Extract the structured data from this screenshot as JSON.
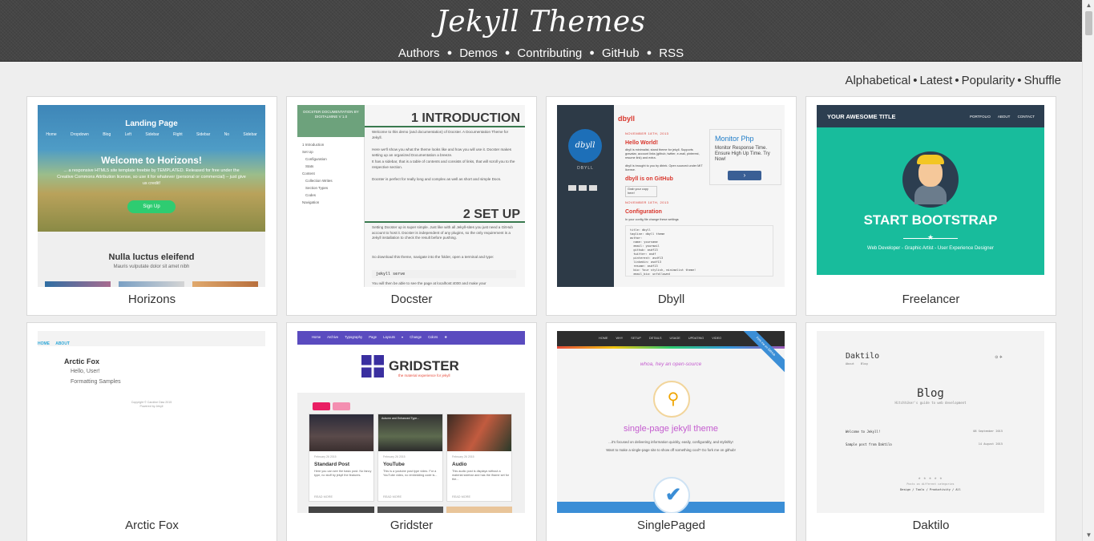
{
  "header": {
    "title": "Jekyll Themes",
    "nav": [
      "Authors",
      "Demos",
      "Contributing",
      "GitHub",
      "RSS"
    ]
  },
  "sort": [
    "Alphabetical",
    "Latest",
    "Popularity",
    "Shuffle"
  ],
  "themes": [
    {
      "name": "Horizons",
      "preview": {
        "title": "Landing Page",
        "nav": "Home Dropdown Blog Left Sidebar Right Sidebar No Sidebar",
        "headline": "Welcome to Horizons!",
        "description": "... a responsive HTML5 site template freebie by TEMPLATED. Released for free under the Creative Commons Attribution license, so use it for whatever (personal or commercial) – just give us credit!",
        "button": "Sign Up",
        "section_title": "Nulla luctus eleifend",
        "section_sub": "Mauris vulputate dolor sit amet nibh"
      }
    },
    {
      "name": "Docster",
      "preview": {
        "side_title": "DOCSTER DOCUMENTATION BY DIGITALMINE V 1.0",
        "side_items": [
          "1 Introduction",
          "Set Up",
          "Configuration",
          "Stats",
          "Content",
          "Collection Writes",
          "Section Types",
          "Codes",
          "Navigation"
        ],
        "h1": "1 INTRODUCTION",
        "intro_1": "Welcome to this demo (and documentation) of Docster. A Documentation Theme for Jekyll.",
        "intro_2": "Here we'll show you what the theme looks like and how you will use it. Docster makes setting up an organized Documentation a breeze.",
        "intro_3": "It has a sidebar, that is a table of contents and consists of links, that will scroll you to the respective section.",
        "intro_4": "Docster is perfect for really long and complex as well as short and simple Docs.",
        "h2": "2 SET UP",
        "setup_1": "Setting Docster up is super simple. Just like with all Jekyll-sites you just need a GitHub account to host it. Docster is independent of any plugins, so the only requirement is a Jekyll installation to check the result before pushing.",
        "setup_2": "So download this theme, navigate into the folder, open a terminal and type:",
        "code": "jekyll serve",
        "setup_3": "You will then be able to see the page at localhost:4000 and make your"
      }
    },
    {
      "name": "Dbyll",
      "preview": {
        "logo": "dbyll",
        "side_name": "DBYLL",
        "brand": "dbyll",
        "date_1": "NOVEMBER 18TH, 2013",
        "post_1": "Hello World!",
        "post_1_text": "dbyll is minimalist, stand theme for jekyll. Supports gravatar, account links (github, twitter, e-mail, pinterest, resume link) and extra.",
        "post_1_text_2": "dbyll is brought to you by dbtek. Open sourced under MIT license.",
        "post_2": "dbyll is on GitHub",
        "post_2_btn": "Grab your copy here!",
        "date_2": "NOVEMBER 18TH, 2013",
        "post_3": "Configuration",
        "post_3_text": "In your config file change these settings",
        "code": "title: dbyll\ntagline: dbyll theme\nauthor:\n  name: yourname\n  email: yourmail\n  github: asdf13\n  twitter: asdf\n  pinterest: asdf13\n  linkedin: asdf13\n  resume: asdf13\n  bio: Your stylish, minimalist theme!\n  email_bio: unfollowed",
        "ad_title": "Monitor Php",
        "ad_text": "Monitor Response Time. Ensure High Up Time. Try Now!"
      }
    },
    {
      "name": "Freelancer",
      "preview": {
        "brand": "YOUR AWESOME TITLE",
        "links": "PORTFOLIO ABOUT CONTACT",
        "headline": "START BOOTSTRAP",
        "sub": "Web Developer - Graphic Artist - User Experience Designer"
      }
    },
    {
      "name": "Arctic Fox",
      "preview": {
        "nav": "HOME ABOUT",
        "title": "Arctic Fox",
        "items": [
          "Hello, User!",
          "Formatting Samples"
        ],
        "copyright": "Copyright © Caroline Diaz 2015",
        "powered": "Powered by Jekyll"
      }
    },
    {
      "name": "Gridster",
      "preview": {
        "menu": "Home Archive Typography Page Layouts ▾ Change Colors ❖",
        "logo": "GRIDSTER",
        "tagline": "the material experience for jekyll",
        "cards": [
          {
            "meta": "February 26 2015",
            "title": "Standard Post",
            "text": "Here you can see the basic post. No fancy type, no stuff by jekyll the features.",
            "more": "READ MORE"
          },
          {
            "meta": "February 26 2015",
            "title": "YouTube",
            "text": "This is a youtube post type video. For a YouTube video, no embedding code is...",
            "more": "READ MORE"
          },
          {
            "meta": "February 26 2015",
            "title": "Audio",
            "text": "This audio post is displays without a material sidebar and has the iframe set for the...",
            "more": "READ MORE"
          }
        ],
        "video_title": "Autumn and Enhanced Type..."
      }
    },
    {
      "name": "SinglePaged",
      "preview": {
        "menu": "HOME WHY SETUP DETAILS USAGE UPDATING VIDEO",
        "ribbon": "Fork me on GitHub",
        "whoa": "whoa, hey an open-source",
        "title": "single-page jekyll theme",
        "line_1": "...it's focused on delivering information quickly, easily, configurably, and stylishly!",
        "line_2": "Want to make a single-page site to show off something cool? Go fork me on github!"
      }
    },
    {
      "name": "Daktilo",
      "preview": {
        "name": "Daktilo",
        "nav": "About Blog",
        "icons": "⊙ ✈",
        "blog": "Blog",
        "blog_sub": "Hitchhiker's guide to web development",
        "posts": [
          {
            "title": "Welcome to Jekyll!",
            "date": "08 September 2015"
          },
          {
            "title": "Sample post from Daktilo",
            "date": "14 August 2015"
          }
        ],
        "footer_stars": "★ ★ ★ ★ ★",
        "footer_sub": "Posts on different categories",
        "footer_cats": "Design / Tools / Productivity / All"
      }
    }
  ]
}
